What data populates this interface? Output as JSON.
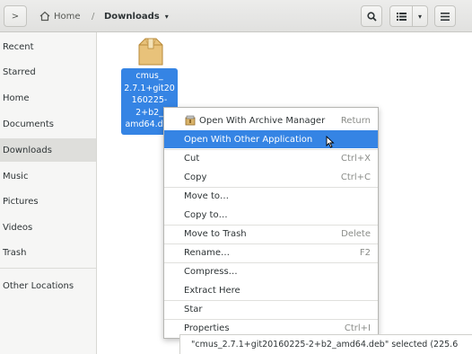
{
  "header": {
    "back_glyph": ">",
    "home_crumb": "Home",
    "separator": "/",
    "current_crumb": "Downloads",
    "crumb_caret": "▾",
    "viewmenu_caret": "▾"
  },
  "sidebar": {
    "items": [
      {
        "label": "Recent"
      },
      {
        "label": "Starred"
      },
      {
        "label": "Home"
      },
      {
        "label": "Documents"
      },
      {
        "label": "Downloads",
        "active": true
      },
      {
        "label": "Music"
      },
      {
        "label": "Pictures"
      },
      {
        "label": "Videos"
      },
      {
        "label": "Trash"
      },
      {
        "label": "Other Locations"
      }
    ]
  },
  "file": {
    "label_lines": [
      "cmus_",
      "2.7.1+git20",
      "160225-",
      "2+b2_",
      "amd64.deb"
    ]
  },
  "context_menu": {
    "items": [
      {
        "label": "Open With Archive Manager",
        "accel": "Return"
      },
      {
        "label": "Open With Other Application",
        "accel": ""
      },
      {
        "label": "Cut",
        "accel": "Ctrl+X"
      },
      {
        "label": "Copy",
        "accel": "Ctrl+C"
      },
      {
        "label": "Move to…",
        "accel": ""
      },
      {
        "label": "Copy to…",
        "accel": ""
      },
      {
        "label": "Move to Trash",
        "accel": "Delete"
      },
      {
        "label": "Rename…",
        "accel": "F2"
      },
      {
        "label": "Compress…",
        "accel": ""
      },
      {
        "label": "Extract Here",
        "accel": ""
      },
      {
        "label": "Star",
        "accel": ""
      },
      {
        "label": "Properties",
        "accel": "Ctrl+I"
      }
    ]
  },
  "statusbar": {
    "text": "\"cmus_2.7.1+git20160225-2+b2_amd64.deb\" selected  (225.6"
  },
  "colors": {
    "accent": "#3584e4",
    "sidebar_bg": "#f6f6f5",
    "headerbar_bg": "#e6e6e4"
  },
  "icons": {
    "back": "chevron-right-icon",
    "home": "home-icon",
    "search": "search-icon",
    "view": "list-view-icon",
    "menu": "hamburger-menu-icon",
    "file": "package-icon",
    "archive_manager": "archive-manager-icon"
  }
}
